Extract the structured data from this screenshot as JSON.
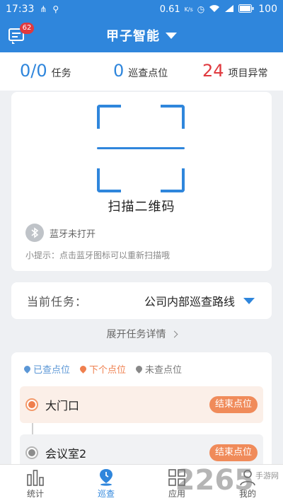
{
  "status_bar": {
    "time": "17:33",
    "speed": "0.61",
    "speed_unit": "K/s",
    "battery": "100"
  },
  "header": {
    "title": "甲子智能",
    "message_badge": "62"
  },
  "stats": {
    "tasks_value": "0/0",
    "tasks_label": "任务",
    "patrol_value": "0",
    "patrol_label": "巡查点位",
    "abnormal_value": "24",
    "abnormal_label": "项目异常"
  },
  "scan": {
    "title": "扫描二维码",
    "bluetooth_status": "蓝牙未打开",
    "tip": "小提示：点击蓝牙图标可以重新扫描哦"
  },
  "task": {
    "label": "当前任务：",
    "value": "公司内部巡查路线"
  },
  "expand_label": "展开任务详情",
  "legend": {
    "checked": "已查点位",
    "next": "下个点位",
    "unchecked": "未查点位"
  },
  "points": [
    {
      "name": "大门口",
      "action": "结束点位"
    },
    {
      "name": "会议室2",
      "action": "结束点位"
    }
  ],
  "nav": {
    "stats": "统计",
    "patrol": "巡查",
    "apps": "应用",
    "mine": "我的"
  },
  "watermark": {
    "number": "2265",
    "site": "手游网"
  },
  "colors": {
    "primary": "#2f86dc",
    "danger": "#e0393e",
    "accent_orange": "#ef7f4e"
  }
}
